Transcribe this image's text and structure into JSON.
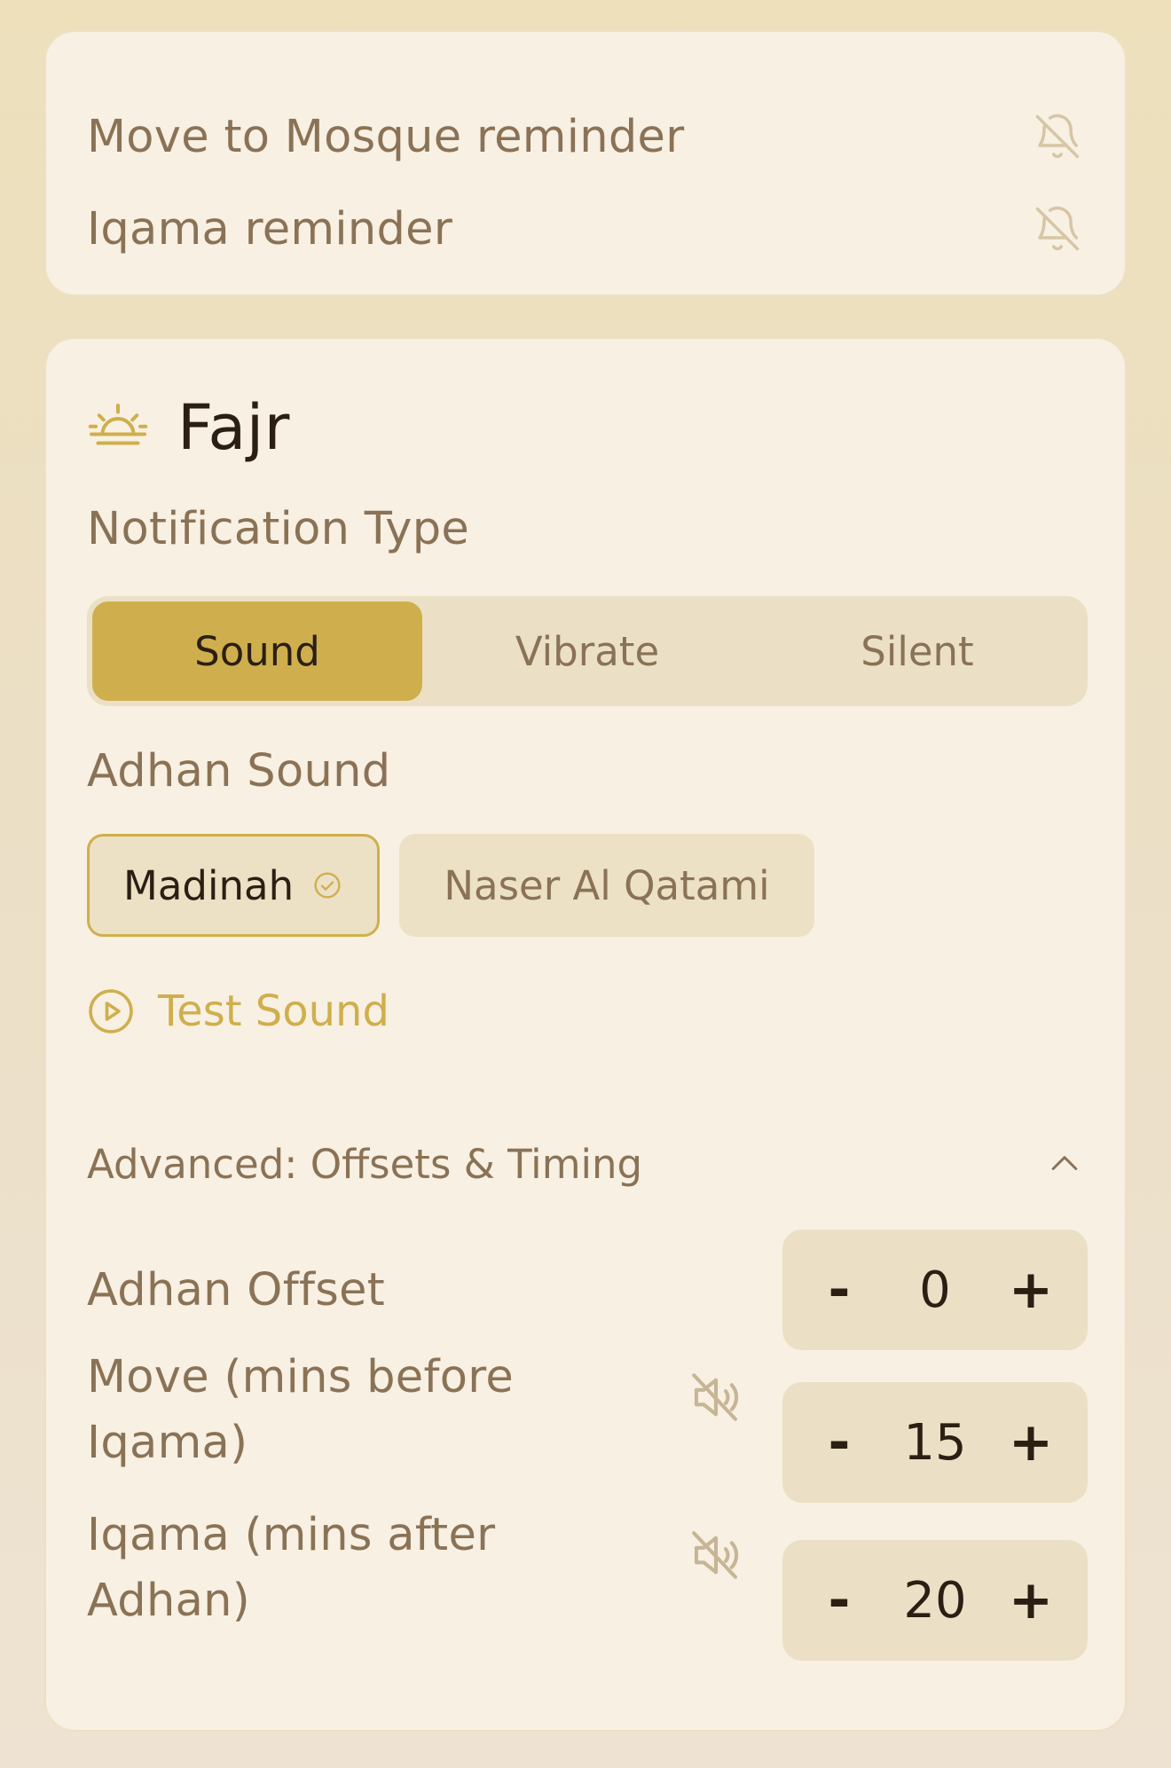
{
  "reminders": {
    "items": [
      {
        "label": "Move to Mosque reminder",
        "icon": "bell-off-icon"
      },
      {
        "label": "Iqama reminder",
        "icon": "bell-off-icon"
      }
    ]
  },
  "fajr": {
    "title": "Fajr",
    "icon": "sunrise-icon",
    "notification_type": {
      "label": "Notification Type",
      "options": [
        "Sound",
        "Vibrate",
        "Silent"
      ],
      "selected": "Sound"
    },
    "adhan_sound": {
      "label": "Adhan Sound",
      "options": [
        "Madinah",
        "Naser Al Qatami"
      ],
      "selected": "Madinah"
    },
    "test_sound_label": "Test Sound",
    "advanced": {
      "label": "Advanced: Offsets & Timing",
      "expanded": true,
      "rows": [
        {
          "label": "Adhan Offset",
          "value": "0",
          "muted_icon": false
        },
        {
          "label_line1": "Move (mins before",
          "label_line2": "Iqama)",
          "value": "15",
          "muted_icon": true
        },
        {
          "label_line1": "Iqama (mins after",
          "label_line2": "Adhan)",
          "value": "20",
          "muted_icon": true
        }
      ],
      "minus": "-",
      "plus": "+"
    }
  },
  "colors": {
    "accent": "#cfaf4d",
    "text_dark": "#2b1f14",
    "text_muted": "#8a7256",
    "card": "#f8f0e2",
    "control_bg": "#ebe0c5"
  }
}
